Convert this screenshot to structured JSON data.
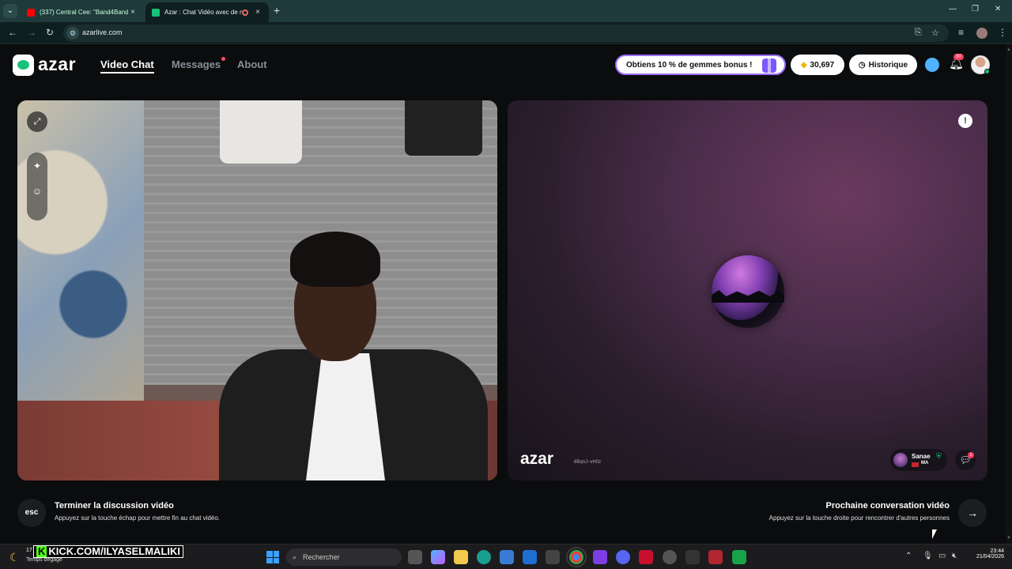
{
  "browser": {
    "tabs": [
      {
        "title": "(337) Central Cee: \"Band4Band\"",
        "favicon": "youtube-icon"
      },
      {
        "title": "Azar : Chat Vidéo avec de nouvelles personnes",
        "favicon": "azar-icon",
        "active": true
      }
    ],
    "url": "azarlive.com"
  },
  "header": {
    "logo": "azar",
    "nav": [
      {
        "label": "Video Chat",
        "active": true
      },
      {
        "label": "Messages",
        "has_dot": true
      },
      {
        "label": "About"
      }
    ],
    "promo_label": "Obtiens 10 % de gemmes bonus !",
    "gems_count": "30,697",
    "history_label": "Historique",
    "notifications_badge": "30"
  },
  "right_panel": {
    "watermark_logo": "azar",
    "watermark_id": "8BqnJ~vH0z",
    "partner_name": "Sanae",
    "partner_country": "MA",
    "chat_badge": "1"
  },
  "controls": {
    "esc_label": "esc",
    "end_title": "Terminer la discussion vidéo",
    "end_subtitle": "Appuyez sur la touche échap pour mettre fin au chat vidéo.",
    "next_title": "Prochaine conversation vidéo",
    "next_subtitle": "Appuyez sur la touche droite pour rencontrer d'autres personnes"
  },
  "taskbar": {
    "weather_temp": "17",
    "weather_desc": "Temps dégagé",
    "overlay_text": "KICK.COM/ILYASELMALIKI",
    "search_placeholder": "Rechercher",
    "time": "23:44",
    "date": "21/04/2026"
  },
  "colors": {
    "accent": "#18c27a",
    "promo_border": "#9a6bff",
    "notification": "#ff3b5c"
  }
}
